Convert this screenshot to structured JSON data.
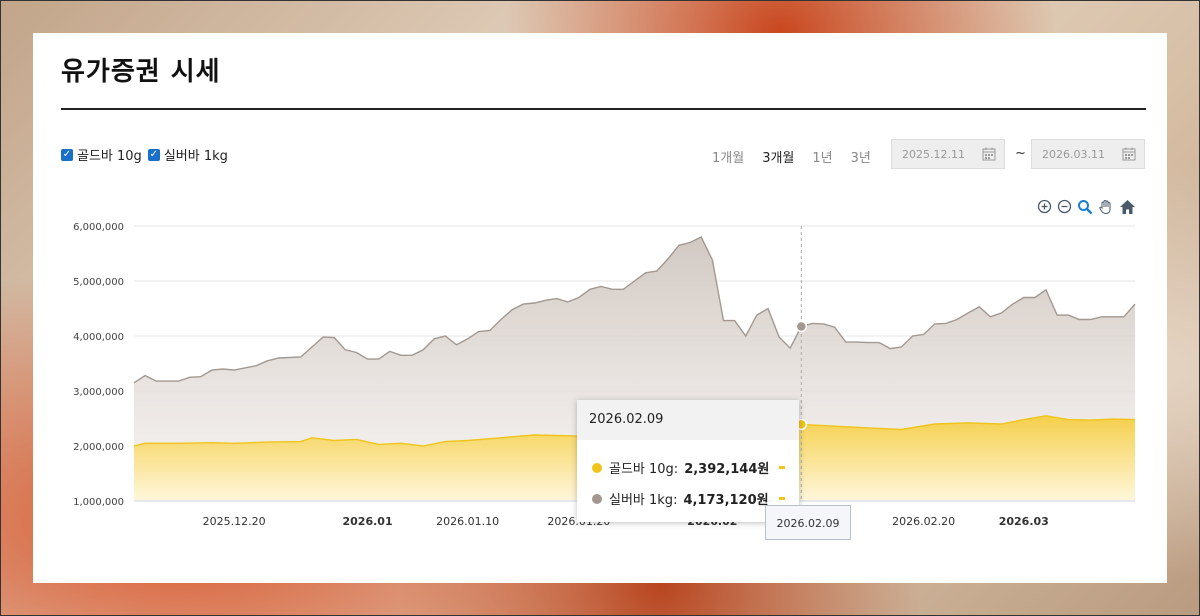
{
  "page": {
    "title": "유가증권 시세"
  },
  "legend": [
    {
      "label": "골드바 10g",
      "color": "#f0c419",
      "checked": true
    },
    {
      "label": "실버바 1kg",
      "color": "#a39891",
      "checked": true
    }
  ],
  "periods": [
    {
      "label": "1개월",
      "active": false
    },
    {
      "label": "3개월",
      "active": true
    },
    {
      "label": "1년",
      "active": false
    },
    {
      "label": "3년",
      "active": false
    }
  ],
  "date_range": {
    "start": "2025.12.11",
    "separator": "~",
    "end": "2026.03.11"
  },
  "toolbar": {
    "icons": [
      "zoom-in-icon",
      "zoom-out-icon",
      "magnify-icon",
      "pan-hand-icon",
      "home-icon"
    ]
  },
  "tooltip": {
    "date": "2026.02.09",
    "rows": [
      {
        "label": "골드바 10g:",
        "value": "2,392,144원",
        "color": "#f0c419"
      },
      {
        "label": "실버바 1kg:",
        "value": "4,173,120원",
        "color": "#a39891"
      }
    ]
  },
  "crosshair_label": "2026.02.09",
  "chart_data": {
    "type": "area",
    "title": "",
    "xlabel": "",
    "ylabel": "",
    "ylim": [
      1000000,
      6000000
    ],
    "yticks": [
      "6,000,000",
      "5,000,000",
      "4,000,000",
      "3,000,000",
      "2,000,000",
      "1,000,000"
    ],
    "xticks": [
      {
        "date": "2025-12-20",
        "label": "2025.12.20",
        "bold": false
      },
      {
        "date": "2026-01-01",
        "label": "2026.01",
        "bold": true
      },
      {
        "date": "2026-01-10",
        "label": "2026.01.10",
        "bold": false
      },
      {
        "date": "2026-01-20",
        "label": "2026.01.20",
        "bold": false
      },
      {
        "date": "2026-02-01",
        "label": "2026.02",
        "bold": true
      },
      {
        "date": "2026-02-09",
        "label": "2026.02.09",
        "bold": false
      },
      {
        "date": "2026-02-20",
        "label": "2026.02.20",
        "bold": false
      },
      {
        "date": "2026-03-01",
        "label": "2026.03",
        "bold": true
      }
    ],
    "grid": true,
    "x_range": [
      "2025-12-11",
      "2026-03-11"
    ],
    "highlight_date": "2026-02-09",
    "series": [
      {
        "name": "실버바 1kg",
        "color": "#a39891",
        "points": [
          [
            "2025-12-11",
            3150000
          ],
          [
            "2025-12-12",
            3280000
          ],
          [
            "2025-12-13",
            3180000
          ],
          [
            "2025-12-15",
            3180000
          ],
          [
            "2025-12-16",
            3250000
          ],
          [
            "2025-12-17",
            3260000
          ],
          [
            "2025-12-18",
            3380000
          ],
          [
            "2025-12-19",
            3400000
          ],
          [
            "2025-12-20",
            3380000
          ],
          [
            "2025-12-22",
            3460000
          ],
          [
            "2025-12-23",
            3550000
          ],
          [
            "2025-12-24",
            3600000
          ],
          [
            "2025-12-26",
            3620000
          ],
          [
            "2025-12-27",
            3800000
          ],
          [
            "2025-12-28",
            3980000
          ],
          [
            "2025-12-29",
            3970000
          ],
          [
            "2025-12-30",
            3750000
          ],
          [
            "2025-12-31",
            3700000
          ],
          [
            "2026-01-01",
            3580000
          ],
          [
            "2026-01-02",
            3580000
          ],
          [
            "2026-01-03",
            3720000
          ],
          [
            "2026-01-04",
            3650000
          ],
          [
            "2026-01-05",
            3650000
          ],
          [
            "2026-01-06",
            3750000
          ],
          [
            "2026-01-07",
            3950000
          ],
          [
            "2026-01-08",
            4000000
          ],
          [
            "2026-01-09",
            3840000
          ],
          [
            "2026-01-10",
            3950000
          ],
          [
            "2026-01-11",
            4080000
          ],
          [
            "2026-01-12",
            4100000
          ],
          [
            "2026-01-13",
            4300000
          ],
          [
            "2026-01-14",
            4480000
          ],
          [
            "2026-01-15",
            4580000
          ],
          [
            "2026-01-16",
            4600000
          ],
          [
            "2026-01-17",
            4650000
          ],
          [
            "2026-01-18",
            4680000
          ],
          [
            "2026-01-19",
            4620000
          ],
          [
            "2026-01-20",
            4700000
          ],
          [
            "2026-01-21",
            4850000
          ],
          [
            "2026-01-22",
            4900000
          ],
          [
            "2026-01-23",
            4850000
          ],
          [
            "2026-01-24",
            4850000
          ],
          [
            "2026-01-25",
            5000000
          ],
          [
            "2026-01-26",
            5150000
          ],
          [
            "2026-01-27",
            5180000
          ],
          [
            "2026-01-28",
            5400000
          ],
          [
            "2026-01-29",
            5650000
          ],
          [
            "2026-01-30",
            5700000
          ],
          [
            "2026-01-31",
            5800000
          ],
          [
            "2026-02-01",
            5380000
          ],
          [
            "2026-02-02",
            4280000
          ],
          [
            "2026-02-03",
            4280000
          ],
          [
            "2026-02-04",
            4000000
          ],
          [
            "2026-02-05",
            4380000
          ],
          [
            "2026-02-06",
            4500000
          ],
          [
            "2026-02-07",
            3980000
          ],
          [
            "2026-02-08",
            3780000
          ],
          [
            "2026-02-09",
            4173120
          ],
          [
            "2026-02-10",
            4230000
          ],
          [
            "2026-02-11",
            4220000
          ],
          [
            "2026-02-12",
            4160000
          ],
          [
            "2026-02-13",
            3890000
          ],
          [
            "2026-02-14",
            3890000
          ],
          [
            "2026-02-15",
            3880000
          ],
          [
            "2026-02-16",
            3880000
          ],
          [
            "2026-02-17",
            3770000
          ],
          [
            "2026-02-18",
            3800000
          ],
          [
            "2026-02-19",
            4000000
          ],
          [
            "2026-02-20",
            4030000
          ],
          [
            "2026-02-21",
            4220000
          ],
          [
            "2026-02-22",
            4230000
          ],
          [
            "2026-02-23",
            4300000
          ],
          [
            "2026-02-24",
            4420000
          ],
          [
            "2026-02-25",
            4530000
          ],
          [
            "2026-02-26",
            4350000
          ],
          [
            "2026-02-27",
            4420000
          ],
          [
            "2026-02-28",
            4580000
          ],
          [
            "2026-03-01",
            4700000
          ],
          [
            "2026-03-02",
            4700000
          ],
          [
            "2026-03-03",
            4840000
          ],
          [
            "2026-03-04",
            4380000
          ],
          [
            "2026-03-05",
            4380000
          ],
          [
            "2026-03-06",
            4300000
          ],
          [
            "2026-03-07",
            4300000
          ],
          [
            "2026-03-08",
            4350000
          ],
          [
            "2026-03-09",
            4350000
          ],
          [
            "2026-03-10",
            4350000
          ],
          [
            "2026-03-11",
            4580000
          ]
        ]
      },
      {
        "name": "골드바 10g",
        "color": "#f0c419",
        "points": [
          [
            "2025-12-11",
            2000000
          ],
          [
            "2025-12-12",
            2050000
          ],
          [
            "2025-12-15",
            2050000
          ],
          [
            "2025-12-18",
            2060000
          ],
          [
            "2025-12-20",
            2050000
          ],
          [
            "2025-12-23",
            2070000
          ],
          [
            "2025-12-26",
            2080000
          ],
          [
            "2025-12-27",
            2150000
          ],
          [
            "2025-12-29",
            2100000
          ],
          [
            "2025-12-31",
            2120000
          ],
          [
            "2026-01-02",
            2030000
          ],
          [
            "2026-01-04",
            2050000
          ],
          [
            "2026-01-06",
            2000000
          ],
          [
            "2026-01-08",
            2080000
          ],
          [
            "2026-01-10",
            2100000
          ],
          [
            "2026-01-13",
            2150000
          ],
          [
            "2026-01-16",
            2200000
          ],
          [
            "2026-01-20",
            2180000
          ],
          [
            "2026-01-25",
            2220000
          ],
          [
            "2026-01-28",
            2250000
          ],
          [
            "2026-01-31",
            2350000
          ],
          [
            "2026-02-03",
            2400000
          ],
          [
            "2026-02-06",
            2380000
          ],
          [
            "2026-02-09",
            2392144
          ],
          [
            "2026-02-12",
            2360000
          ],
          [
            "2026-02-15",
            2330000
          ],
          [
            "2026-02-18",
            2300000
          ],
          [
            "2026-02-21",
            2400000
          ],
          [
            "2026-02-24",
            2420000
          ],
          [
            "2026-02-27",
            2400000
          ],
          [
            "2026-03-01",
            2480000
          ],
          [
            "2026-03-03",
            2550000
          ],
          [
            "2026-03-05",
            2480000
          ],
          [
            "2026-03-07",
            2470000
          ],
          [
            "2026-03-09",
            2490000
          ],
          [
            "2026-03-11",
            2480000
          ]
        ]
      }
    ]
  }
}
